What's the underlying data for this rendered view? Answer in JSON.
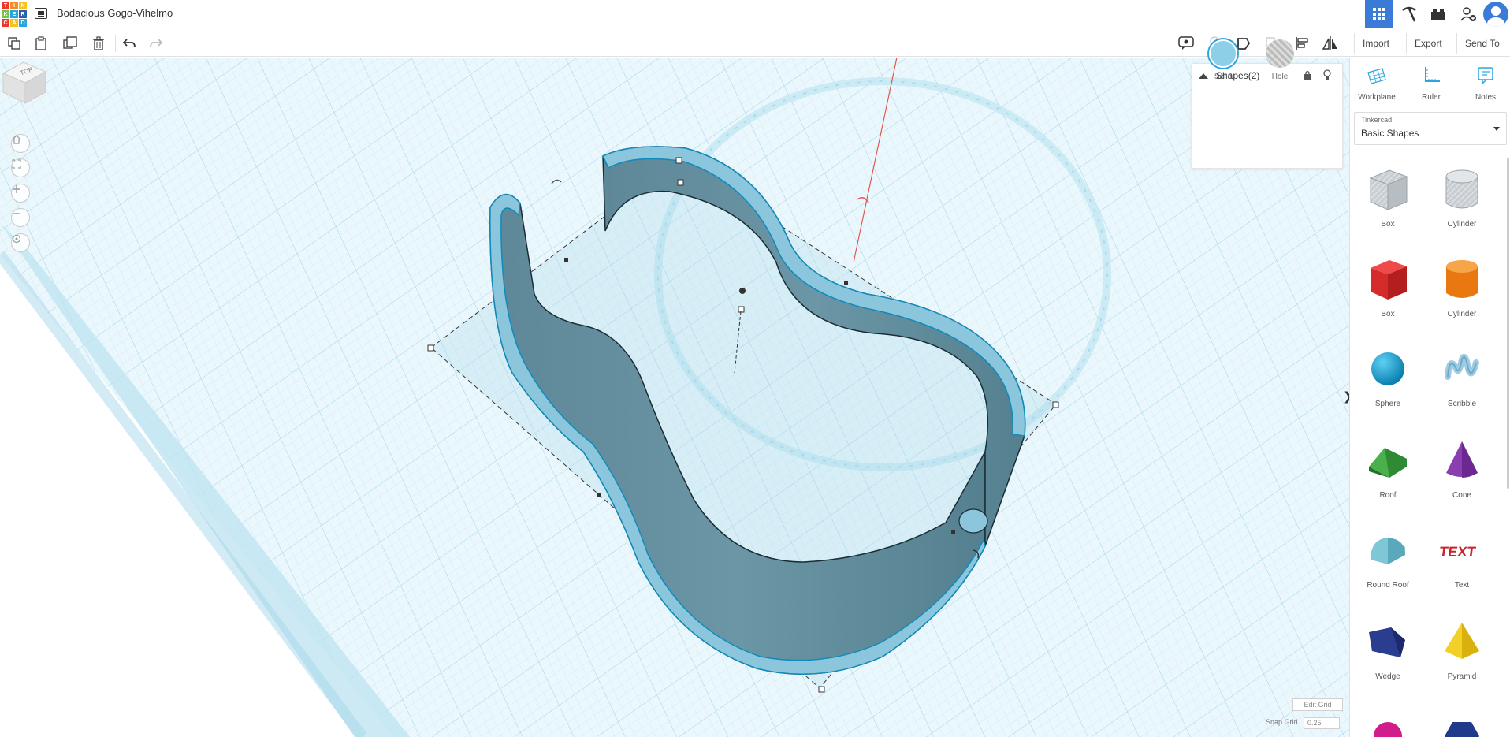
{
  "header": {
    "logo_letters": [
      "T",
      "I",
      "N",
      "K",
      "E",
      "R",
      "C",
      "A",
      "D"
    ],
    "logo_colors": [
      "#e8382f",
      "#f28c28",
      "#f6c21c",
      "#7ac142",
      "#2aa6df",
      "#2b5fa8",
      "#e8382f",
      "#f6c21c",
      "#2aa6df"
    ],
    "project_title": "Bodacious Gogo-Vihelmo",
    "accent": "#3b7bd8"
  },
  "toolbar": {
    "import_label": "Import",
    "export_label": "Export",
    "send_to_label": "Send To"
  },
  "viewcube": {
    "face_label": "TOP"
  },
  "inspector": {
    "title": "Shapes(2)",
    "solid_label": "Solid",
    "hole_label": "Hole",
    "solid_color": "#8ecfe8"
  },
  "right_panel": {
    "tools": [
      {
        "label": "Workplane",
        "icon": "workplane-icon"
      },
      {
        "label": "Ruler",
        "icon": "ruler-icon"
      },
      {
        "label": "Notes",
        "icon": "notes-icon"
      }
    ],
    "library_owner": "Tinkercad",
    "library_name": "Basic Shapes",
    "shapes": [
      {
        "label": "Box",
        "icon": "box-hole-icon"
      },
      {
        "label": "Cylinder",
        "icon": "cylinder-hole-icon"
      },
      {
        "label": "Box",
        "icon": "box-icon"
      },
      {
        "label": "Cylinder",
        "icon": "cylinder-icon"
      },
      {
        "label": "Sphere",
        "icon": "sphere-icon"
      },
      {
        "label": "Scribble",
        "icon": "scribble-icon"
      },
      {
        "label": "Roof",
        "icon": "roof-icon"
      },
      {
        "label": "Cone",
        "icon": "cone-icon"
      },
      {
        "label": "Round Roof",
        "icon": "round-roof-icon"
      },
      {
        "label": "Text",
        "icon": "text-icon"
      },
      {
        "label": "Wedge",
        "icon": "wedge-icon"
      },
      {
        "label": "Pyramid",
        "icon": "pyramid-icon"
      }
    ]
  },
  "grid_controls": {
    "edit_grid_label": "Edit Grid",
    "snap_grid_label": "Snap Grid",
    "snap_grid_value": "0.25"
  }
}
